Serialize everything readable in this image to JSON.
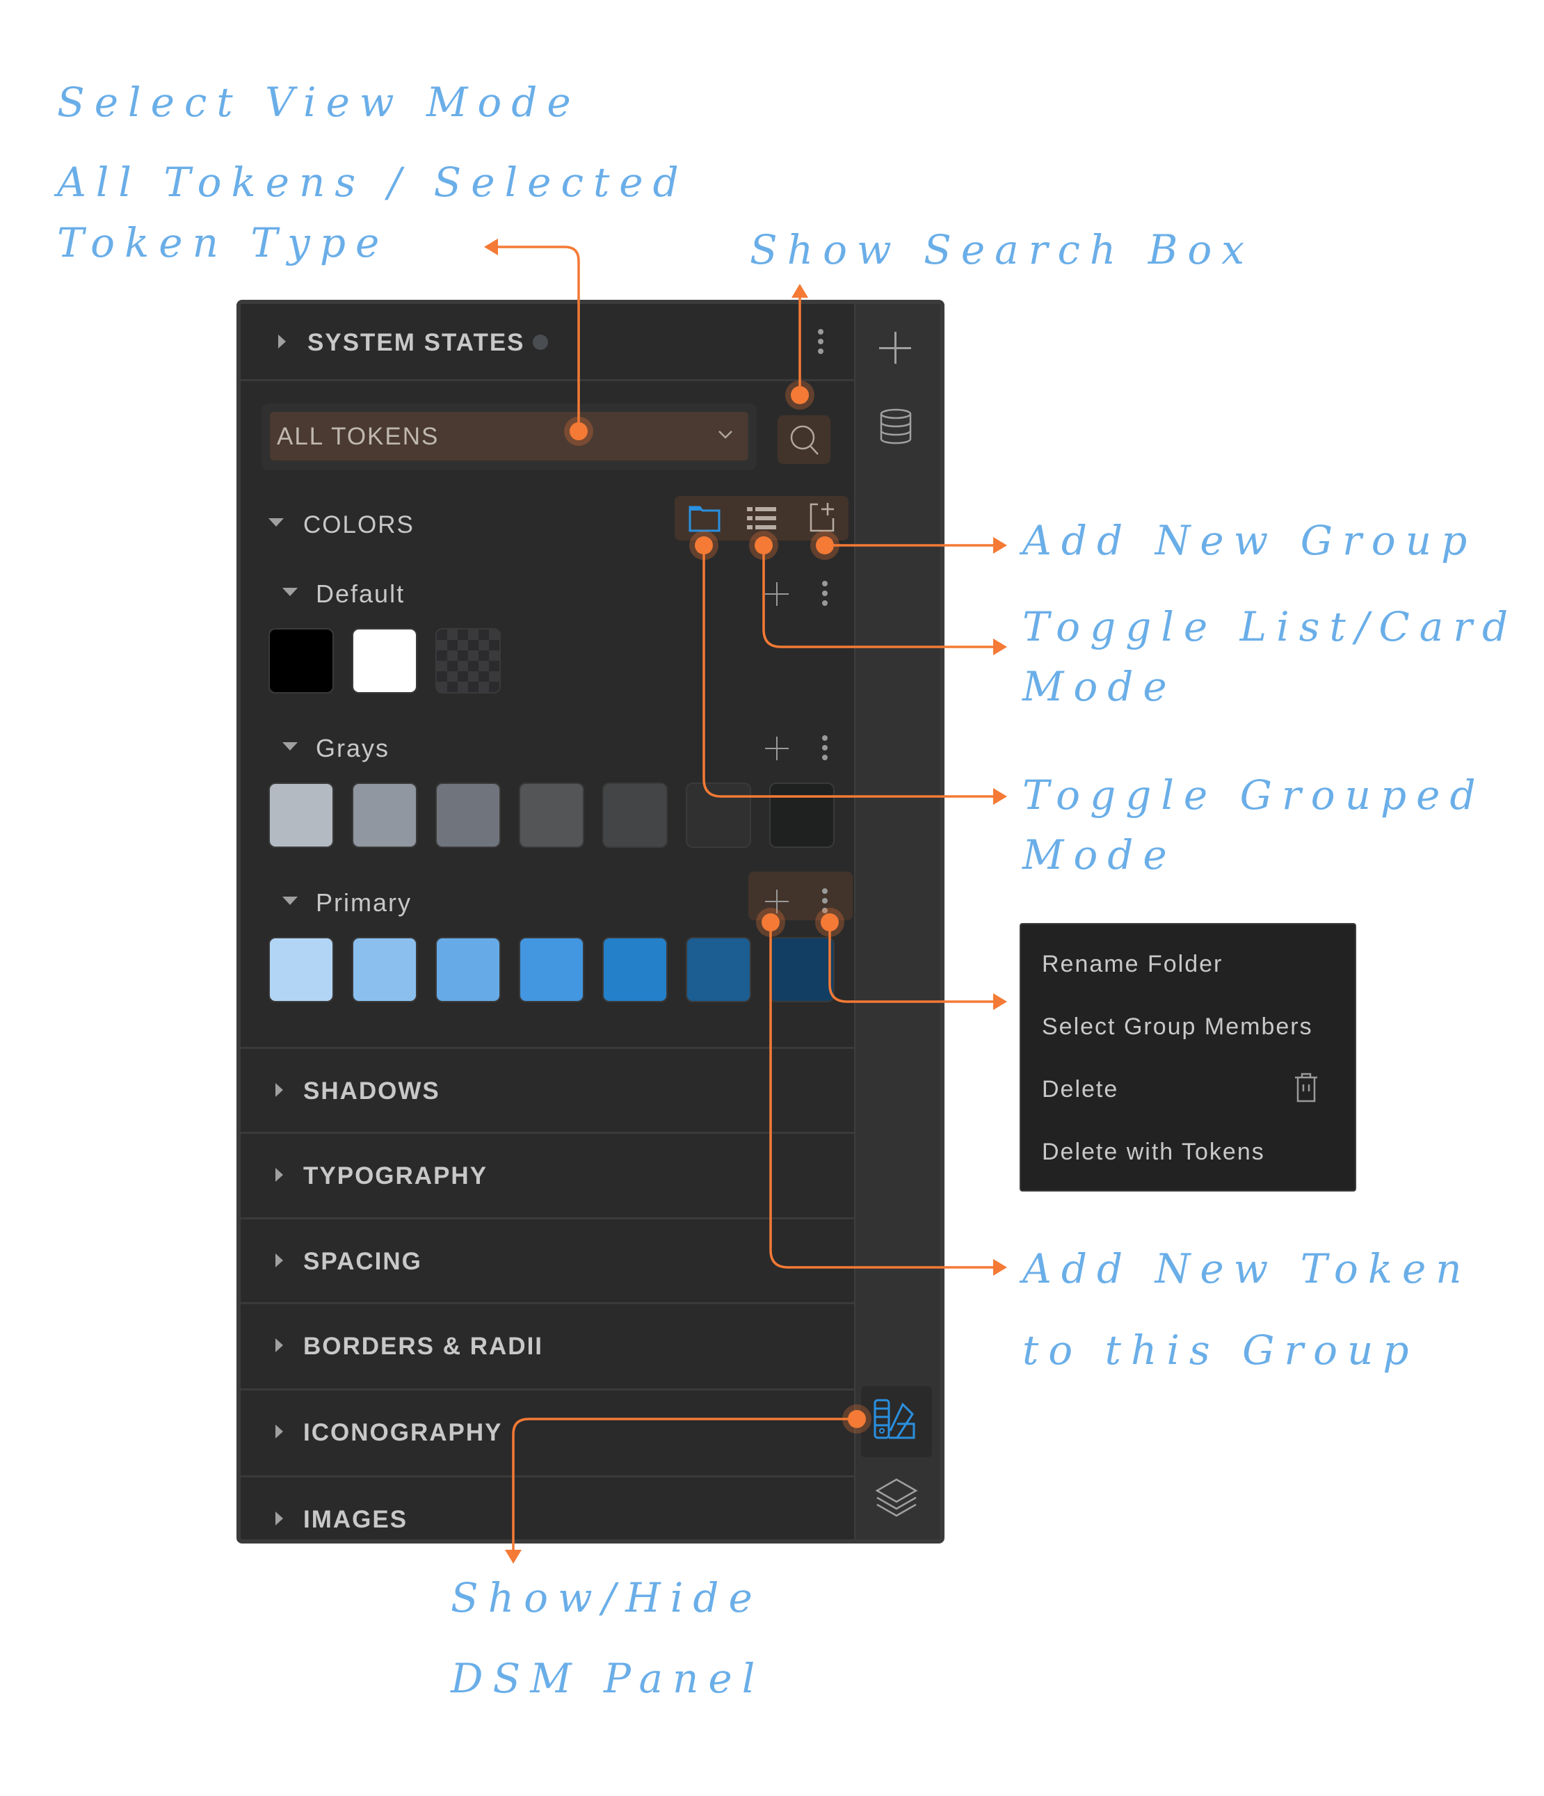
{
  "annotations": {
    "select_view_mode": "Select View Mode",
    "all_tokens_line1": "All Tokens / Selected",
    "all_tokens_line2": "Token Type",
    "show_search_box": "Show Search Box",
    "add_new_group": "Add New Group",
    "toggle_list_card_line1": "Toggle List/Card",
    "toggle_list_card_line2": "Mode",
    "toggle_grouped_line1": "Toggle Grouped",
    "toggle_grouped_line2": "Mode",
    "add_new_token_line1": "Add New Token",
    "add_new_token_line2": "to this Group",
    "show_hide_dsm_line1": "Show/Hide",
    "show_hide_dsm_line2": "DSM Panel"
  },
  "panel": {
    "system_states": {
      "label": "SYSTEM STATES",
      "status_color": "#4a4d52"
    },
    "view_select": {
      "value": "ALL TOKENS"
    },
    "colors_section": {
      "label": "COLORS",
      "toolbar": {
        "grouped_icon": "folder-icon",
        "list_icon": "list-icon",
        "add_group_icon": "add-group-icon",
        "active_color": "#2a90e0"
      },
      "groups": [
        {
          "label": "Default",
          "swatches": [
            "#000000",
            "#ffffff",
            "transparent"
          ]
        },
        {
          "label": "Grays",
          "swatches": [
            "#b4bac2",
            "#9097a0",
            "#70757d",
            "#545557",
            "#444547",
            "#303030",
            "#1f2020"
          ]
        },
        {
          "label": "Primary",
          "swatches": [
            "#b3d5f5",
            "#8bc0ee",
            "#66abe8",
            "#4396e0",
            "#2480c9",
            "#1c5d92",
            "#133e63"
          ]
        }
      ]
    },
    "sections": [
      "SHADOWS",
      "TYPOGRAPHY",
      "SPACING",
      "BORDERS & RADII",
      "ICONOGRAPHY",
      "IMAGES"
    ]
  },
  "rail": {
    "add_icon": "plus-icon",
    "database_icon": "database-icon",
    "dsm_icon": "swatch-book-icon",
    "layers_icon": "layers-icon"
  },
  "context_menu": {
    "items": [
      "Rename Folder",
      "Select Group Members",
      "Delete",
      "Delete with Tokens"
    ]
  },
  "colors": {
    "accent": "#f47a35",
    "annotation": "#6aaee8",
    "active_icon": "#2a90e0"
  }
}
